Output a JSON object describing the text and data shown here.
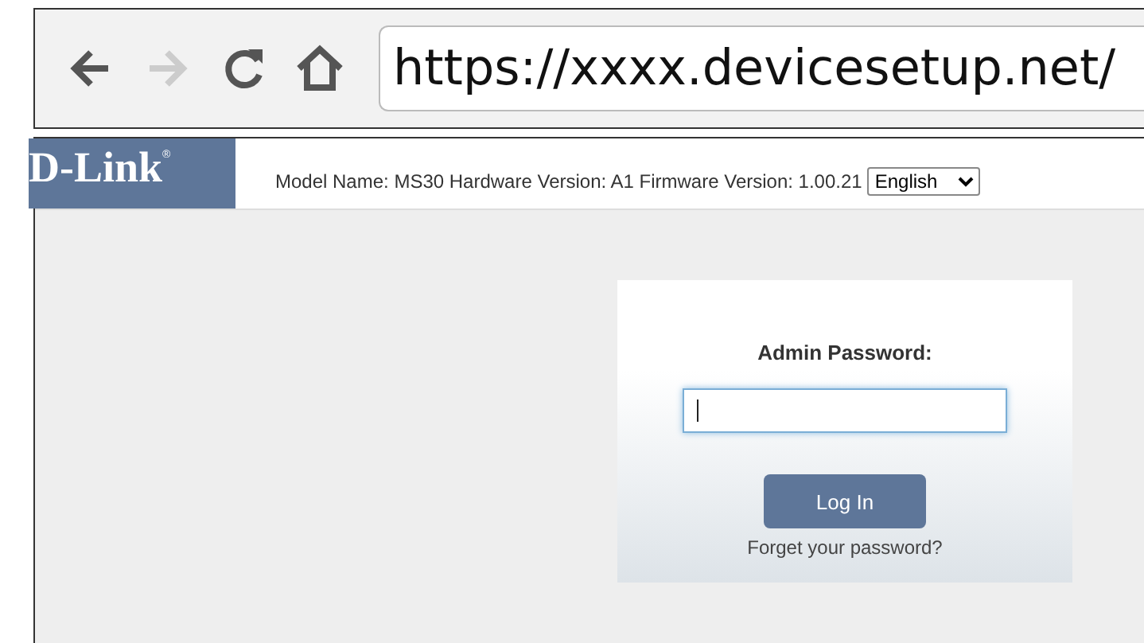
{
  "browser": {
    "url": "https://xxxx.devicesetup.net/",
    "forward_disabled": true
  },
  "header": {
    "logo": "D-Link",
    "logo_mark": "®",
    "device_info": "Model Name: MS30 Hardware Version: A1 Firmware Version: 1.00.21",
    "language": "English"
  },
  "login": {
    "label": "Admin Password:",
    "password_focused": true,
    "button": "Log In",
    "forgot_link": "Forget your password?"
  }
}
